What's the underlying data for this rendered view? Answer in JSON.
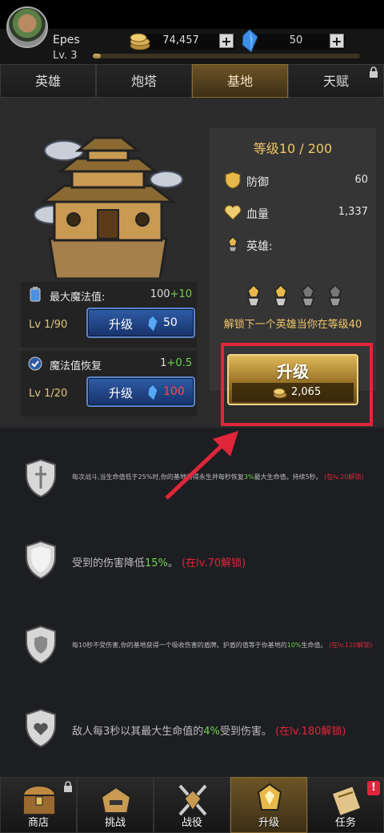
{
  "player": {
    "name": "Epes",
    "level": "Lv. 3",
    "xp_fraction": 0.03
  },
  "currency": {
    "coins": "74,457",
    "gems": "50"
  },
  "tabs": [
    {
      "label": "英雄",
      "active": false
    },
    {
      "label": "炮塔",
      "active": false
    },
    {
      "label": "基地",
      "active": true
    },
    {
      "label": "天赋",
      "active": false,
      "locked": true
    }
  ],
  "skills": [
    {
      "label": "最大魔法值:",
      "value": "100",
      "bonus": "+10",
      "level": "Lv 1/90",
      "button": "升级",
      "cost": "50",
      "cost_affordable": true
    },
    {
      "label": "魔法值恢复",
      "value": "1",
      "bonus": "+0.5",
      "level": "Lv 1/20",
      "button": "升级",
      "cost": "100",
      "cost_affordable": false
    }
  ],
  "stats": {
    "title": "等级10 / 200",
    "defense_label": "防御",
    "defense_value": "60",
    "hp_label": "血量",
    "hp_value": "1,337",
    "heroes_label": "英雄:",
    "unlock_note": "解锁下一个英雄当你在等级40"
  },
  "upgrade": {
    "label": "升级",
    "cost": "2,065"
  },
  "perks": [
    {
      "pre": "每次战斗,当生命值低于25%时,你的基地将得永生并每秒恢复",
      "green": "3%",
      "post": "最大生命值。持续5秒。",
      "lock": "(在lv.20解锁)"
    },
    {
      "pre": "受到的伤害降低",
      "green": "15%",
      "post": "。",
      "lock": "(在lv.70解锁)"
    },
    {
      "pre": "每10秒不受伤害,你的基地获得一个吸收伤害的盾牌。护盾的值等于你基地的",
      "green": "10%",
      "post": "生命值。",
      "lock": "(在lv.120解锁)"
    },
    {
      "pre": "敌人每3秒以其最大生命值的",
      "green": "4%",
      "post": "受到伤害。",
      "lock": "(在lv.180解锁)"
    }
  ],
  "nav": [
    {
      "label": "商店",
      "icon": "chest-icon",
      "locked": true
    },
    {
      "label": "挑战",
      "icon": "helmet-icon"
    },
    {
      "label": "战役",
      "icon": "crossed-swords-icon"
    },
    {
      "label": "升级",
      "icon": "upgrade-emblem-icon",
      "active": true
    },
    {
      "label": "任务",
      "icon": "scroll-icon",
      "alert": "!"
    }
  ],
  "colors": {
    "gold": "#f0c868",
    "bonus_green": "#6fd14d",
    "alert_red": "#e0263a",
    "active_tab": "#6d5426"
  }
}
